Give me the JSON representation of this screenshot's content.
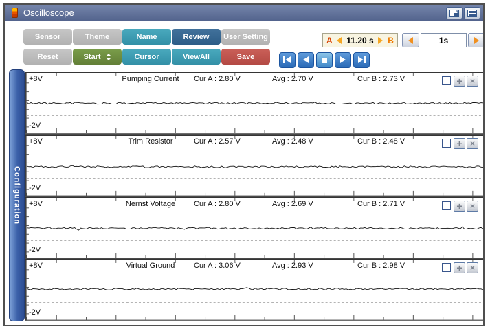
{
  "window": {
    "title": "Oscilloscope"
  },
  "titlebar": {
    "icons": {
      "app": "scope-app-icon",
      "layout": "layout-icon",
      "split": "split-panes-icon"
    }
  },
  "toolbar": {
    "row1": [
      {
        "label": "Sensor",
        "style": "gray"
      },
      {
        "label": "Theme",
        "style": "gray"
      },
      {
        "label": "Name",
        "style": "teal"
      },
      {
        "label": "Review",
        "style": "blue"
      },
      {
        "label": "User Setting",
        "style": "gray"
      }
    ],
    "row2": [
      {
        "label": "Reset",
        "style": "gray"
      },
      {
        "label": "Start",
        "style": "green",
        "spinner": true
      },
      {
        "label": "Cursor",
        "style": "teal"
      },
      {
        "label": "ViewAll",
        "style": "teal"
      },
      {
        "label": "Save",
        "style": "red"
      }
    ],
    "transport_icons": [
      "skip-to-start-icon",
      "step-back-icon",
      "stop-icon",
      "play-icon",
      "skip-to-end-icon"
    ],
    "cursor_readout": {
      "a": "A",
      "time": "11.20 s",
      "b": "B"
    },
    "interval": {
      "value": "1s"
    }
  },
  "sidebar": {
    "tab_label": "Configuration"
  },
  "panel_controls": {
    "add_glyph": "+",
    "close_glyph": "×"
  },
  "colors": {
    "titlebar": "#5c6d96",
    "accent_teal": "#3a9bb1",
    "accent_blue": "#35688f",
    "accent_green": "#6d923e",
    "accent_red": "#c1534e",
    "transport_blue": "#2e72bd",
    "cursor_a": "#e00000",
    "cursor_b": "#4a4a4a",
    "time_box_bg": "#f8f4e1"
  },
  "chart_data": {
    "type": "line",
    "y_top_label": "+8V",
    "y_bottom_label": "-2V",
    "ylim": [
      -2,
      8
    ],
    "grid": "0V dashed line per panel",
    "cursor_a_label": "A",
    "cursor_b_label": "B",
    "channels": [
      {
        "name": "Pumping Current",
        "cur_a_v": 2.8,
        "avg_v": 2.7,
        "cur_b_v": 2.73,
        "cur_a_text": "Cur A : 2.80 V",
        "avg_text": "Avg : 2.70 V",
        "cur_b_text": "Cur B : 2.73 V"
      },
      {
        "name": "Trim Resistor",
        "cur_a_v": 2.57,
        "avg_v": 2.48,
        "cur_b_v": 2.48,
        "cur_a_text": "Cur A : 2.57 V",
        "avg_text": "Avg : 2.48 V",
        "cur_b_text": "Cur B : 2.48 V"
      },
      {
        "name": "Nernst Voltage",
        "cur_a_v": 2.8,
        "avg_v": 2.69,
        "cur_b_v": 2.71,
        "cur_a_text": "Cur A : 2.80 V",
        "avg_text": "Avg : 2.69 V",
        "cur_b_text": "Cur B : 2.71 V"
      },
      {
        "name": "Virtual Ground",
        "cur_a_v": 3.06,
        "avg_v": 2.93,
        "cur_b_v": 2.98,
        "cur_a_text": "Cur A : 3.06 V",
        "avg_text": "Avg : 2.93 V",
        "cur_b_text": "Cur B : 2.98 V"
      }
    ]
  }
}
